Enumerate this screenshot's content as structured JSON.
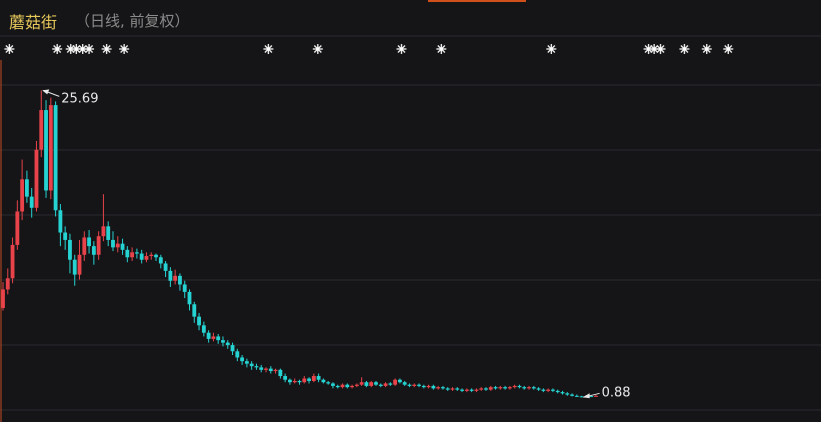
{
  "header": {
    "name": "蘑菇街",
    "sub": "（日线, 前复权）",
    "accent": "#e6c85a"
  },
  "chart_data": {
    "type": "candlestick",
    "title": "蘑菇街",
    "subtitle": "（日线, 前复权）",
    "up_color": "#e8434a",
    "down_color": "#26d3d3",
    "ylim": [
      0.5,
      27.5
    ],
    "grid": true,
    "event_marker_icon": "sparkle-icon",
    "event_markers_x": [
      0.8,
      6.8,
      8.5,
      9.2,
      10,
      10.8,
      13,
      15.2,
      33.3,
      39.5,
      50,
      55,
      68.8,
      81,
      81.7,
      82.5,
      85.5,
      88.3,
      91
    ],
    "annotations": {
      "high_label": "25.69",
      "low_label": "0.88"
    },
    "candles": [
      [
        0,
        8.1,
        9.6,
        10.2,
        7.9
      ],
      [
        0.6,
        9.6,
        10.5,
        11.3,
        9.2
      ],
      [
        1.2,
        10.5,
        13.2,
        13.8,
        10.1
      ],
      [
        1.8,
        13.2,
        15.9,
        16.8,
        12.8
      ],
      [
        2.4,
        15.9,
        18.5,
        20.1,
        15.2
      ],
      [
        3,
        18.5,
        17.1,
        19.2,
        16.6
      ],
      [
        3.6,
        17.1,
        16.2,
        17.8,
        15.4
      ],
      [
        4.2,
        16.2,
        20.9,
        21.6,
        15.9
      ],
      [
        4.8,
        20.9,
        24.1,
        25.69,
        20.3
      ],
      [
        5.4,
        24.1,
        17.6,
        24.9,
        17
      ],
      [
        6,
        17.6,
        24.5,
        25.1,
        16.9
      ],
      [
        6.6,
        24.5,
        16,
        24.8,
        15.5
      ],
      [
        7.2,
        16,
        14.2,
        16.5,
        13.1
      ],
      [
        7.8,
        14.2,
        13.6,
        14.7,
        12.8
      ],
      [
        8.4,
        13.6,
        12,
        14.1,
        10.9
      ],
      [
        9,
        12,
        10.8,
        12.4,
        9.9
      ],
      [
        9.6,
        10.8,
        12.4,
        13.6,
        10.4
      ],
      [
        10.2,
        12.4,
        13.8,
        14.3,
        11.9
      ],
      [
        10.8,
        13.8,
        13.1,
        14.4,
        12.5
      ],
      [
        11.4,
        13.1,
        12.4,
        13.5,
        11.6
      ],
      [
        12,
        12.4,
        13.9,
        14.3,
        12
      ],
      [
        12.6,
        13.9,
        14.7,
        17.3,
        13.5
      ],
      [
        13.2,
        14.7,
        13.6,
        15.1,
        13.1
      ],
      [
        13.8,
        13.6,
        13,
        14.3,
        12.7
      ],
      [
        14.4,
        13,
        13.3,
        13.9,
        12.6
      ],
      [
        15,
        13.3,
        12.8,
        13.7,
        12.4
      ],
      [
        15.6,
        12.8,
        12.2,
        13.1,
        11.8
      ],
      [
        16.2,
        12.2,
        12.6,
        13,
        11.9
      ],
      [
        16.8,
        12.6,
        12.5,
        12.9,
        12.1
      ],
      [
        17.4,
        12.5,
        12,
        12.8,
        11.7
      ],
      [
        18,
        12,
        12.3,
        12.6,
        11.8
      ],
      [
        18.6,
        12.3,
        12.4,
        12.6,
        12
      ],
      [
        19.2,
        12.4,
        12.2,
        12.5,
        11.9
      ],
      [
        19.8,
        12.2,
        11.7,
        12.4,
        11.3
      ],
      [
        20.4,
        11.7,
        11.1,
        11.9,
        10.6
      ],
      [
        21,
        11.1,
        10.3,
        11.4,
        9.8
      ],
      [
        21.6,
        10.3,
        10.7,
        11.2,
        10
      ],
      [
        22.2,
        10.7,
        10,
        10.9,
        9.5
      ],
      [
        22.8,
        10,
        9.4,
        10.3,
        8.9
      ],
      [
        23.4,
        9.4,
        8.4,
        9.6,
        7.9
      ],
      [
        24,
        8.4,
        7.4,
        8.6,
        6.9
      ],
      [
        24.6,
        7.4,
        6.7,
        7.7,
        6.3
      ],
      [
        25.2,
        6.7,
        6.1,
        7,
        5.8
      ],
      [
        25.8,
        6.1,
        5.6,
        6.3,
        5.3
      ],
      [
        26.4,
        5.6,
        5.8,
        6.1,
        5.4
      ],
      [
        27,
        5.8,
        5.5,
        6,
        5.2
      ],
      [
        27.6,
        5.5,
        5.3,
        5.8,
        5
      ],
      [
        28.2,
        5.3,
        5.1,
        5.5,
        4.8
      ],
      [
        28.8,
        5.1,
        4.6,
        5.3,
        4.3
      ],
      [
        29.4,
        4.6,
        4.1,
        4.8,
        3.8
      ],
      [
        30,
        4.1,
        3.8,
        4.3,
        3.5
      ],
      [
        30.6,
        3.8,
        3.6,
        4,
        3.3
      ],
      [
        31.2,
        3.6,
        3.4,
        3.8,
        3.1
      ],
      [
        31.8,
        3.4,
        3.3,
        3.6,
        3.1
      ],
      [
        32.4,
        3.3,
        3.1,
        3.5,
        2.9
      ],
      [
        33,
        3.1,
        3.2,
        3.3,
        2.9
      ],
      [
        33.6,
        3.2,
        3,
        3.4,
        2.8
      ],
      [
        34.2,
        3,
        3.1,
        3.2,
        2.8
      ],
      [
        34.8,
        3.1,
        2.6,
        3.2,
        2.4
      ],
      [
        35.4,
        2.6,
        2.3,
        2.8,
        2.1
      ],
      [
        36,
        2.3,
        2.1,
        2.4,
        1.9
      ],
      [
        36.6,
        2.1,
        2.2,
        2.4,
        2
      ],
      [
        37.2,
        2.2,
        2.1,
        2.3,
        1.9
      ],
      [
        37.8,
        2.1,
        2.4,
        2.6,
        2
      ],
      [
        38.4,
        2.4,
        2.2,
        2.5,
        2
      ],
      [
        39,
        2.2,
        2.6,
        2.8,
        2.1
      ],
      [
        39.6,
        2.6,
        2.3,
        2.8,
        2.1
      ],
      [
        40.2,
        2.3,
        2.1,
        2.4,
        2
      ],
      [
        40.8,
        2.1,
        2,
        2.2,
        1.9
      ],
      [
        41.4,
        2,
        1.8,
        2.1,
        1.6
      ],
      [
        42,
        1.8,
        1.7,
        1.9,
        1.6
      ],
      [
        42.6,
        1.7,
        1.9,
        2,
        1.6
      ],
      [
        43.2,
        1.9,
        1.7,
        2,
        1.6
      ],
      [
        43.8,
        1.7,
        1.8,
        1.9,
        1.6
      ],
      [
        44.4,
        1.8,
        1.9,
        2,
        1.7
      ],
      [
        45,
        1.9,
        2.1,
        2.5,
        1.8
      ],
      [
        45.6,
        2.1,
        1.8,
        2.2,
        1.7
      ],
      [
        46.2,
        1.8,
        2.1,
        2.2,
        1.7
      ],
      [
        46.8,
        2.1,
        1.9,
        2.2,
        1.8
      ],
      [
        47.4,
        1.9,
        1.8,
        2,
        1.7
      ],
      [
        48,
        1.8,
        2,
        2.1,
        1.7
      ],
      [
        48.6,
        2,
        1.9,
        2.1,
        1.8
      ],
      [
        49.2,
        1.9,
        2.3,
        2.4,
        1.8
      ],
      [
        49.8,
        2.3,
        2.1,
        2.4,
        2
      ],
      [
        50.4,
        2.1,
        1.9,
        2.2,
        1.8
      ],
      [
        51,
        1.9,
        1.8,
        2,
        1.7
      ],
      [
        51.6,
        1.8,
        1.9,
        2,
        1.7
      ],
      [
        52.2,
        1.9,
        1.8,
        2,
        1.7
      ],
      [
        52.8,
        1.8,
        1.7,
        1.9,
        1.6
      ],
      [
        53.4,
        1.7,
        1.8,
        1.9,
        1.6
      ],
      [
        54,
        1.8,
        1.6,
        1.9,
        1.5
      ],
      [
        54.6,
        1.6,
        1.7,
        1.8,
        1.5
      ],
      [
        55.2,
        1.7,
        1.6,
        1.8,
        1.5
      ],
      [
        55.8,
        1.6,
        1.5,
        1.7,
        1.4
      ],
      [
        56.4,
        1.5,
        1.6,
        1.7,
        1.4
      ],
      [
        57,
        1.6,
        1.5,
        1.7,
        1.4
      ],
      [
        57.6,
        1.5,
        1.4,
        1.6,
        1.3
      ],
      [
        58.2,
        1.4,
        1.5,
        1.6,
        1.3
      ],
      [
        58.8,
        1.5,
        1.4,
        1.6,
        1.3
      ],
      [
        59.4,
        1.4,
        1.5,
        1.6,
        1.3
      ],
      [
        60,
        1.5,
        1.6,
        1.7,
        1.4
      ],
      [
        60.6,
        1.6,
        1.5,
        1.7,
        1.4
      ],
      [
        61.2,
        1.5,
        1.7,
        1.8,
        1.4
      ],
      [
        61.8,
        1.7,
        1.6,
        1.8,
        1.5
      ],
      [
        62.4,
        1.6,
        1.7,
        1.8,
        1.5
      ],
      [
        63,
        1.7,
        1.6,
        1.8,
        1.5
      ],
      [
        63.6,
        1.6,
        1.7,
        1.8,
        1.5
      ],
      [
        64.2,
        1.7,
        1.8,
        1.9,
        1.6
      ],
      [
        64.8,
        1.8,
        1.7,
        1.9,
        1.6
      ],
      [
        65.4,
        1.7,
        1.6,
        1.8,
        1.5
      ],
      [
        66,
        1.6,
        1.7,
        1.8,
        1.5
      ],
      [
        66.6,
        1.7,
        1.6,
        1.8,
        1.5
      ],
      [
        67.2,
        1.6,
        1.5,
        1.7,
        1.4
      ],
      [
        67.8,
        1.5,
        1.4,
        1.6,
        1.3
      ],
      [
        68.4,
        1.4,
        1.5,
        1.6,
        1.3
      ],
      [
        69,
        1.5,
        1.4,
        1.6,
        1.3
      ],
      [
        69.6,
        1.4,
        1.3,
        1.5,
        1.2
      ],
      [
        70.2,
        1.3,
        1.2,
        1.4,
        1.1
      ],
      [
        70.8,
        1.2,
        1.1,
        1.3,
        1
      ],
      [
        71.4,
        1.1,
        1,
        1.2,
        0.95
      ],
      [
        72,
        1,
        0.96,
        1.1,
        0.9
      ],
      [
        72.6,
        0.96,
        0.92,
        1,
        0.88
      ],
      [
        73.2,
        0.92,
        0.98,
        1.05,
        0.9
      ],
      [
        73.8,
        0.98,
        0.95,
        1.05,
        0.92
      ],
      [
        74.4,
        0.95,
        1,
        1.05,
        0.93
      ]
    ],
    "xlim": [
      0,
      100
    ]
  }
}
